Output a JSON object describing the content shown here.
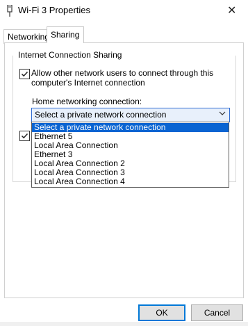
{
  "window": {
    "title": "Wi-Fi 3 Properties",
    "close_glyph": "✕",
    "icon": "network-adapter-icon"
  },
  "tabs": [
    {
      "label": "Networking"
    },
    {
      "label": "Sharing",
      "active": true
    }
  ],
  "sharing": {
    "group_label": "Internet Connection Sharing",
    "allow_checkbox": {
      "checked": true,
      "label": "Allow other network users to connect through this computer's Internet connection"
    },
    "home_connection_label": "Home networking connection:",
    "select": {
      "value": "Select a private network connection",
      "options": [
        "Select a private network connection",
        "Ethernet 5",
        "Local Area Connection",
        "Ethernet 3",
        "Local Area Connection 2",
        "Local Area Connection 3",
        "Local Area Connection 4"
      ]
    },
    "control_checkbox": {
      "checked": true
    }
  },
  "buttons": {
    "ok": "OK",
    "cancel": "Cancel"
  },
  "colors": {
    "accent": "#0078d7",
    "selection": "#0a64d2"
  }
}
